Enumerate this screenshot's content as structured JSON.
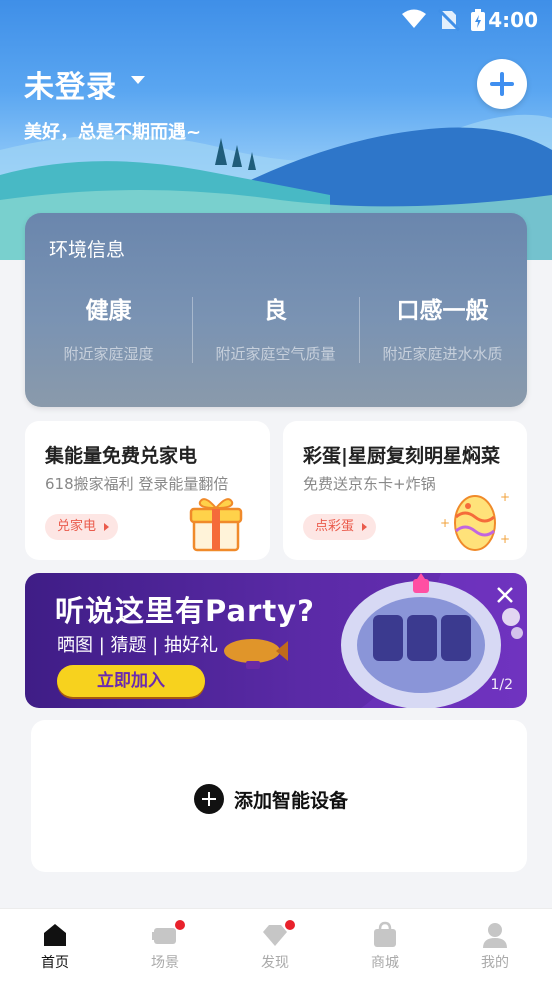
{
  "status_bar": {
    "time": "4:00"
  },
  "header": {
    "title": "未登录",
    "subtitle": "美好，总是不期而遇~"
  },
  "environment": {
    "heading": "环境信息",
    "items": [
      {
        "value": "健康",
        "label": "附近家庭湿度"
      },
      {
        "value": "良",
        "label": "附近家庭空气质量"
      },
      {
        "value": "口感一般",
        "label": "附近家庭进水水质"
      }
    ]
  },
  "promos": [
    {
      "title": "集能量免费兑家电",
      "subtitle": "618搬家福利  登录能量翻倍",
      "button": "兑家电"
    },
    {
      "title": "彩蛋|星厨复刻明星焖菜",
      "subtitle": "免费送京东卡+炸锅",
      "button": "点彩蛋"
    }
  ],
  "banner": {
    "title": "听说这里有Party?",
    "subtitle": "晒图 | 猜题 | 抽好礼",
    "button": "立即加入",
    "pager": "1/2"
  },
  "device": {
    "add_label": "添加智能设备"
  },
  "tabs": [
    {
      "label": "首页",
      "icon": "home-icon",
      "active": true
    },
    {
      "label": "场景",
      "icon": "scene-icon",
      "badge": true
    },
    {
      "label": "发现",
      "icon": "discover-icon",
      "badge": true
    },
    {
      "label": "商城",
      "icon": "shop-bag-icon"
    },
    {
      "label": "我的",
      "icon": "profile-icon"
    }
  ],
  "colors": {
    "accent": "#3f8ff0",
    "badge": "#e8212b",
    "pill_text": "#ea5b4c",
    "banner_button": "#f7d21e"
  }
}
